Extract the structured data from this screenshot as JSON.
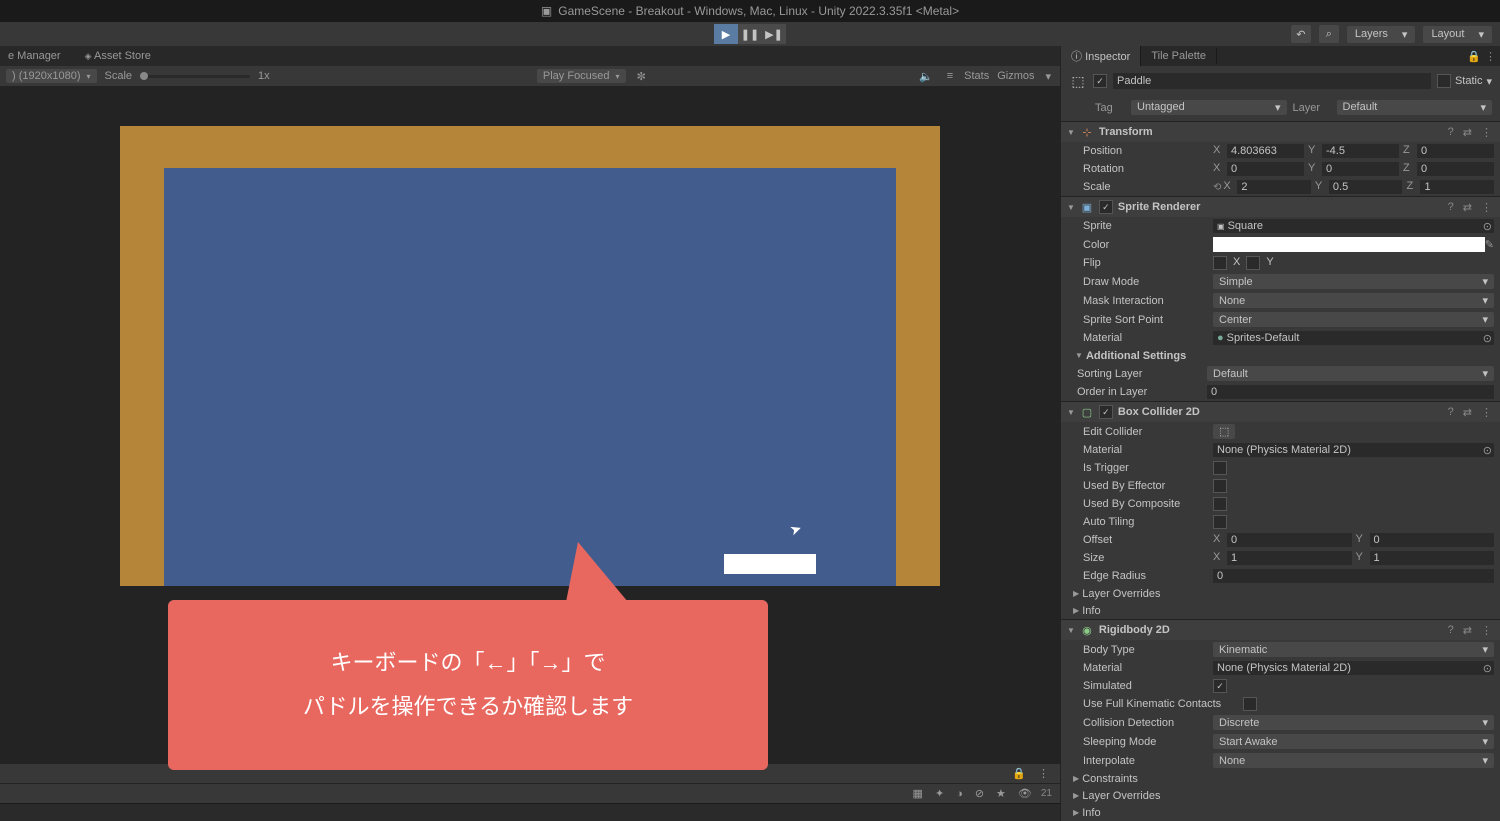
{
  "titlebar": "GameScene - Breakout - Windows, Mac, Linux - Unity 2022.3.35f1 <Metal>",
  "top_right": {
    "layers": "Layers",
    "layout": "Layout"
  },
  "tabs": {
    "package_manager": "e Manager",
    "asset_store": "Asset Store"
  },
  "game_toolbar": {
    "resolution": ") (1920x1080)",
    "scale_label": "Scale",
    "scale_value": "1x",
    "play_focused": "Play Focused",
    "stats": "Stats",
    "gizmos": "Gizmos"
  },
  "bottom_bar": {
    "count": "21"
  },
  "callout": {
    "line1": "キーボードの「←」「→」で",
    "line2": "パドルを操作できるか確認します"
  },
  "inspector": {
    "tabs": {
      "inspector": "Inspector",
      "tile_palette": "Tile Palette"
    },
    "object_name": "Paddle",
    "static_label": "Static",
    "tag_label": "Tag",
    "tag_value": "Untagged",
    "layer_label": "Layer",
    "layer_value": "Default"
  },
  "transform": {
    "title": "Transform",
    "position": {
      "label": "Position",
      "x": "4.803663",
      "y": "-4.5",
      "z": "0"
    },
    "rotation": {
      "label": "Rotation",
      "x": "0",
      "y": "0",
      "z": "0"
    },
    "scale": {
      "label": "Scale",
      "x": "2",
      "y": "0.5",
      "z": "1"
    }
  },
  "sprite_renderer": {
    "title": "Sprite Renderer",
    "sprite": {
      "label": "Sprite",
      "value": "Square"
    },
    "color": {
      "label": "Color"
    },
    "flip": {
      "label": "Flip",
      "x": "X",
      "y": "Y"
    },
    "draw_mode": {
      "label": "Draw Mode",
      "value": "Simple"
    },
    "mask": {
      "label": "Mask Interaction",
      "value": "None"
    },
    "sort_point": {
      "label": "Sprite Sort Point",
      "value": "Center"
    },
    "material": {
      "label": "Material",
      "value": "Sprites-Default"
    },
    "additional": "Additional Settings",
    "sorting_layer": {
      "label": "Sorting Layer",
      "value": "Default"
    },
    "order": {
      "label": "Order in Layer",
      "value": "0"
    }
  },
  "box_collider": {
    "title": "Box Collider 2D",
    "edit": "Edit Collider",
    "material": {
      "label": "Material",
      "value": "None (Physics Material 2D)"
    },
    "is_trigger": "Is Trigger",
    "used_by_effector": "Used By Effector",
    "used_by_composite": "Used By Composite",
    "auto_tiling": "Auto Tiling",
    "offset": {
      "label": "Offset",
      "x": "0",
      "y": "0"
    },
    "size": {
      "label": "Size",
      "x": "1",
      "y": "1"
    },
    "edge_radius": {
      "label": "Edge Radius",
      "value": "0"
    },
    "layer_overrides": "Layer Overrides",
    "info": "Info"
  },
  "rigidbody": {
    "title": "Rigidbody 2D",
    "body_type": {
      "label": "Body Type",
      "value": "Kinematic"
    },
    "material": {
      "label": "Material",
      "value": "None (Physics Material 2D)"
    },
    "simulated": "Simulated",
    "full_kinematic": "Use Full Kinematic Contacts",
    "collision": {
      "label": "Collision Detection",
      "value": "Discrete"
    },
    "sleeping": {
      "label": "Sleeping Mode",
      "value": "Start Awake"
    },
    "interpolate": {
      "label": "Interpolate",
      "value": "None"
    },
    "constraints": "Constraints",
    "layer_overrides": "Layer Overrides",
    "info": "Info"
  }
}
